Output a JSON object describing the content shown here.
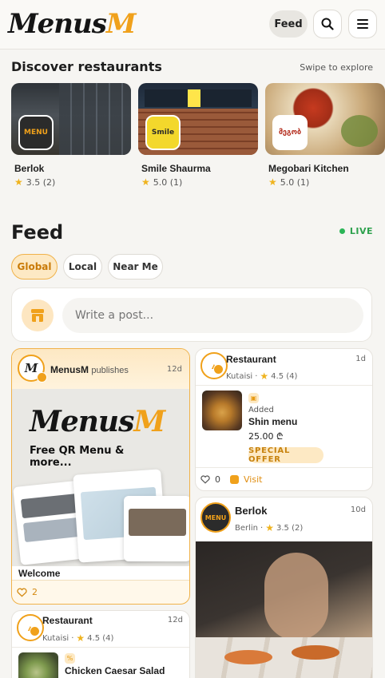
{
  "header": {
    "logo_text": "Menus",
    "logo_accent": "M",
    "feed_label": "Feed",
    "icons": [
      "search-icon",
      "menu-icon"
    ]
  },
  "discover": {
    "title": "Discover restaurants",
    "hint": "Swipe to explore",
    "restaurants": [
      {
        "name": "Berlok",
        "rating": "3.5 (2)",
        "logo_text": "MENU"
      },
      {
        "name": "Smile Shaurma",
        "rating": "5.0 (1)",
        "logo_text": "Smile"
      },
      {
        "name": "Megobari Kitchen",
        "rating": "5.0 (1)",
        "logo_text": "მეგობ"
      }
    ]
  },
  "feed": {
    "title": "Feed",
    "live_label": "LIVE",
    "tabs": [
      {
        "label": "Global",
        "active": true
      },
      {
        "label": "Local",
        "active": false
      },
      {
        "label": "Near Me",
        "active": false
      }
    ],
    "composer_placeholder": "Write a post..."
  },
  "posts": {
    "menusm": {
      "author": "MenusM",
      "action": "publishes",
      "time": "12d",
      "promo_logo": "Menus",
      "promo_logo_accent": "M",
      "promo_text": "Free QR Menu & more...",
      "caption": "Welcome",
      "likes": "2"
    },
    "shin": {
      "author": "Restaurant",
      "time": "1d",
      "city": "Kutaisi",
      "rating": "4.5 (4)",
      "added_label": "Added",
      "item_name": "Shin menu",
      "price": "25.00 ₾",
      "badge": "SPECIAL OFFER",
      "likes": "0",
      "visit_label": "Visit"
    },
    "berlok": {
      "author": "Berlok",
      "time": "10d",
      "city": "Berlin",
      "rating": "3.5 (2)"
    },
    "caesar": {
      "author": "Restaurant",
      "time": "12d",
      "city": "Kutaisi",
      "rating": "4.5 (4)",
      "item_name": "Chicken Caesar Salad"
    }
  },
  "colors": {
    "accent": "#f0a11b",
    "live": "#2da14d",
    "background": "#f6f5f2"
  }
}
